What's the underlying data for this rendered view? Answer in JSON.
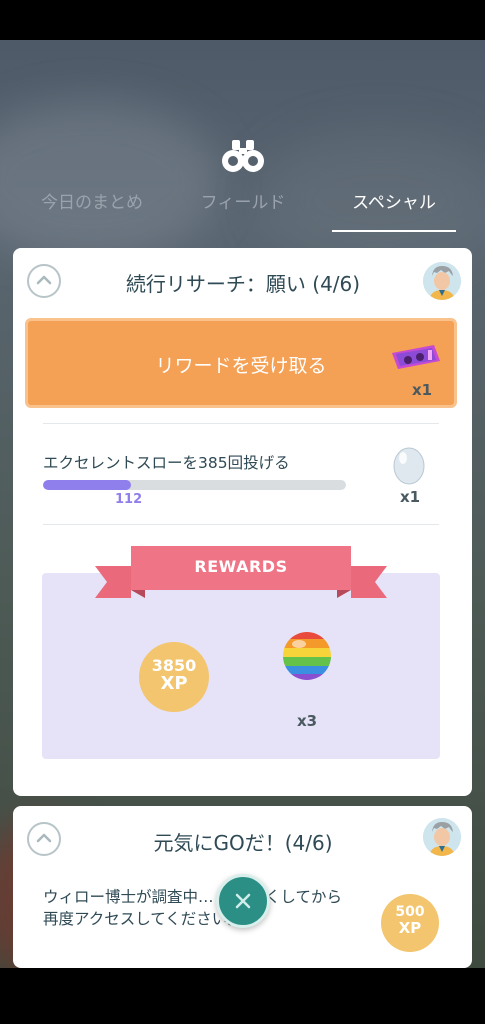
{
  "tabs": [
    {
      "label": "今日のまとめ"
    },
    {
      "label": "フィールド"
    },
    {
      "label": "スペシャル",
      "active": true
    }
  ],
  "cards": [
    {
      "title": "続行リサーチ：願い (4/6)",
      "claim": {
        "label": "リワードを受け取る",
        "reward_qty": "x1"
      },
      "task": {
        "text": "エクセレントスローを385回投げる",
        "progress_value": 112,
        "progress_target": 385,
        "progress_label": "112",
        "reward_qty": "x1"
      },
      "rewards": {
        "ribbon_label": "REWARDS",
        "xp_amount": "3850",
        "xp_unit": "XP",
        "berry_qty": "x3"
      }
    },
    {
      "title": "元気にGOだ！(4/6)",
      "text": "ウィロー博士が調査中… しばらくしてから再度アクセスしてください。",
      "xp_amount": "500",
      "xp_unit": "XP"
    }
  ],
  "colors": {
    "claim_button": "#f4a055",
    "progress_fill": "#8f7fec",
    "rewards_ribbon": "#ea6a7c",
    "xp_badge": "#f2c56e",
    "close_button": "#2b8f86"
  },
  "icons": [
    "binoculars-icon",
    "chevron-up-icon",
    "professor-avatar",
    "rocket-raid-pass-icon",
    "egg-icon",
    "rainbow-berry-icon",
    "close-icon"
  ]
}
